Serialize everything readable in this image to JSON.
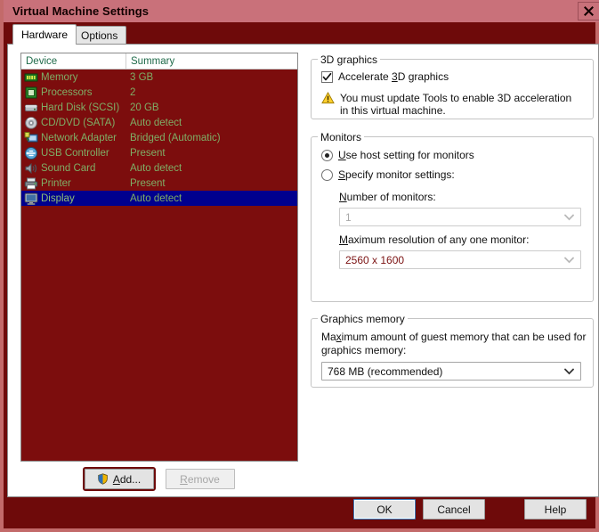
{
  "window": {
    "title": "Virtual Machine Settings",
    "close_icon": "close-icon"
  },
  "tabs": [
    {
      "label": "Hardware",
      "active": true
    },
    {
      "label": "Options",
      "active": false
    }
  ],
  "device_list": {
    "columns": [
      "Device",
      "Summary"
    ],
    "rows": [
      {
        "icon": "memory-icon",
        "device": "Memory",
        "summary": "3 GB",
        "selected": false
      },
      {
        "icon": "processor-icon",
        "device": "Processors",
        "summary": "2",
        "selected": false
      },
      {
        "icon": "hard-disk-icon",
        "device": "Hard Disk (SCSI)",
        "summary": "20 GB",
        "selected": false
      },
      {
        "icon": "cd-dvd-icon",
        "device": "CD/DVD (SATA)",
        "summary": "Auto detect",
        "selected": false
      },
      {
        "icon": "network-adapter-icon",
        "device": "Network Adapter",
        "summary": "Bridged (Automatic)",
        "selected": false
      },
      {
        "icon": "usb-controller-icon",
        "device": "USB Controller",
        "summary": "Present",
        "selected": false
      },
      {
        "icon": "sound-card-icon",
        "device": "Sound Card",
        "summary": "Auto detect",
        "selected": false
      },
      {
        "icon": "printer-icon",
        "device": "Printer",
        "summary": "Present",
        "selected": false
      },
      {
        "icon": "display-icon",
        "device": "Display",
        "summary": "Auto detect",
        "selected": true
      }
    ]
  },
  "list_buttons": {
    "add": {
      "label_prefix": "",
      "label": "Add...",
      "icon": "shield-icon",
      "enabled": true,
      "focused": true
    },
    "remove": {
      "label": "Remove",
      "enabled": false
    }
  },
  "graphics_3d": {
    "group_title": "3D graphics",
    "accelerate": {
      "label_before": "Accelerate ",
      "label_mnemonic": "3",
      "label_after": "D graphics",
      "checked": true
    },
    "warning_icon": "warning-icon",
    "warning_text": "You must update Tools to enable 3D acceleration in this virtual machine."
  },
  "monitors": {
    "group_title": "Monitors",
    "use_host": {
      "label_mnemonic": "U",
      "label_after": "se host setting for monitors",
      "selected": true
    },
    "specify": {
      "label_mnemonic": "S",
      "label_after": "pecify monitor settings:",
      "selected": false
    },
    "number_of_monitors": {
      "label_mnemonic": "N",
      "label_after": "umber of monitors:",
      "value": "1",
      "enabled": false
    },
    "max_resolution": {
      "label_mnemonic": "M",
      "label_after": "aximum resolution of any one monitor:",
      "value": "2560 x 1600",
      "enabled": false
    }
  },
  "graphics_memory": {
    "group_title": "Graphics memory",
    "label_before": "Ma",
    "label_mnemonic": "x",
    "label_line1_after": "imum amount of guest memory that can be used for",
    "label_line2": "graphics memory:",
    "value": "768 MB (recommended)",
    "enabled": true
  },
  "dialog_buttons": {
    "ok": "OK",
    "cancel": "Cancel",
    "help": "Help"
  },
  "colors": {
    "titlebar": "#c9717a",
    "frame": "#6e0a0a",
    "frame_border": "#c36a6a",
    "list_bg": "#7c0d0d",
    "list_text": "#7fae66",
    "selection": "#00008e",
    "column_header_text": "#1f6b4a",
    "value_red": "#7c1414"
  }
}
